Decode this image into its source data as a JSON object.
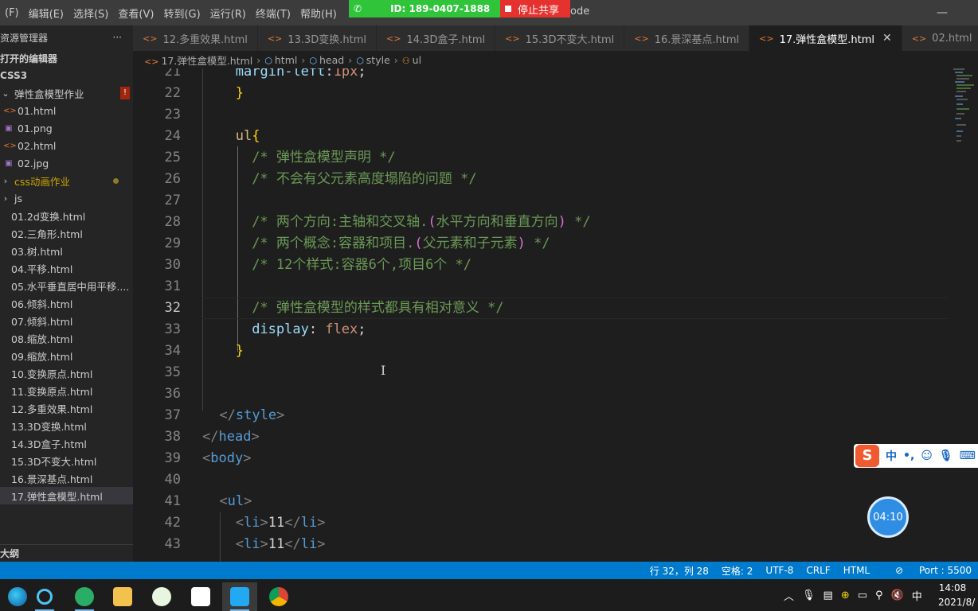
{
  "menu": [
    "(F)",
    "编辑(E)",
    "选择(S)",
    "查看(V)",
    "转到(G)",
    "运行(R)",
    "终端(T)",
    "帮助(H)"
  ],
  "share": {
    "id_label": "ID: 189-0407-1888",
    "stop_label": "停止共享",
    "title_tail": "ode"
  },
  "sidebar": {
    "header": "资源管理器",
    "more": "···",
    "open_editors": "打开的编辑器",
    "root": "CSS3",
    "folder": "弹性盒模型作业",
    "folder_badge": "!",
    "items": [
      {
        "label": "01.html",
        "icon": "html"
      },
      {
        "label": "01.png",
        "icon": "image"
      },
      {
        "label": "02.html",
        "icon": "html"
      },
      {
        "label": "02.jpg",
        "icon": "image"
      }
    ],
    "css_anim_folder": "css动画作业",
    "js_folder": "js",
    "files": [
      "01.2d变换.html",
      "02.三角形.html",
      "03.树.html",
      "04.平移.html",
      "05.水平垂直居中用平移....",
      "06.倾斜.html",
      "07.倾斜.html",
      "08.缩放.html",
      "09.缩放.html",
      "10.变换原点.html",
      "11.变换原点.html",
      "12.多重效果.html",
      "13.3D变换.html",
      "14.3D盒子.html",
      "15.3D不变大.html",
      "16.景深基点.html",
      "17.弹性盒模型.html"
    ],
    "outline": "大纲"
  },
  "tabs": [
    {
      "label": "12.多重效果.html"
    },
    {
      "label": "13.3D变换.html"
    },
    {
      "label": "14.3D盒子.html"
    },
    {
      "label": "15.3D不变大.html"
    },
    {
      "label": "16.景深基点.html"
    },
    {
      "label": "17.弹性盒模型.html",
      "active": true
    },
    {
      "label": "02.html"
    }
  ],
  "breadcrumb": [
    "17.弹性盒模型.html",
    "html",
    "head",
    "style",
    "ul"
  ],
  "code_lines": [
    {
      "n": "21",
      "text": "margin-left:1px;"
    },
    {
      "n": "22",
      "text": "}"
    },
    {
      "n": "23",
      "text": ""
    },
    {
      "n": "24",
      "text": "ul{"
    },
    {
      "n": "25",
      "text": "/* 弹性盒模型声明 */"
    },
    {
      "n": "26",
      "text": "/* 不会有父元素高度塌陷的问题 */"
    },
    {
      "n": "27",
      "text": ""
    },
    {
      "n": "28",
      "text": "/* 两个方向:主轴和交叉轴.(水平方向和垂直方向) */"
    },
    {
      "n": "29",
      "text": "/* 两个概念:容器和项目.(父元素和子元素) */"
    },
    {
      "n": "30",
      "text": "/* 12个样式:容器6个,项目6个 */"
    },
    {
      "n": "31",
      "text": ""
    },
    {
      "n": "32",
      "text": "/* 弹性盒模型的样式都具有相对意义 */"
    },
    {
      "n": "33",
      "text": "display: flex;"
    },
    {
      "n": "34",
      "text": "}"
    },
    {
      "n": "35",
      "text": ""
    },
    {
      "n": "36",
      "text": ""
    },
    {
      "n": "37",
      "text": "</style>"
    },
    {
      "n": "38",
      "text": "</head>"
    },
    {
      "n": "39",
      "text": "<body>"
    },
    {
      "n": "40",
      "text": ""
    },
    {
      "n": "41",
      "text": "<ul>"
    },
    {
      "n": "42",
      "text": "<li>11</li>"
    },
    {
      "n": "43",
      "text": "<li>11</li>"
    }
  ],
  "ime": {
    "lang": "中",
    "punct": "•,"
  },
  "timer": "04:10",
  "status": {
    "position": "行 32，列 28",
    "spaces": "空格: 2",
    "encoding": "UTF-8",
    "eol": "CRLF",
    "language": "HTML",
    "port": "Port : 5500"
  },
  "taskbar": {
    "input_lang": "中",
    "time": "14:08",
    "date": "2021/8/"
  },
  "colors": {
    "accent": "#007acc",
    "share_green": "#2fc43a",
    "share_red": "#e5322f"
  }
}
